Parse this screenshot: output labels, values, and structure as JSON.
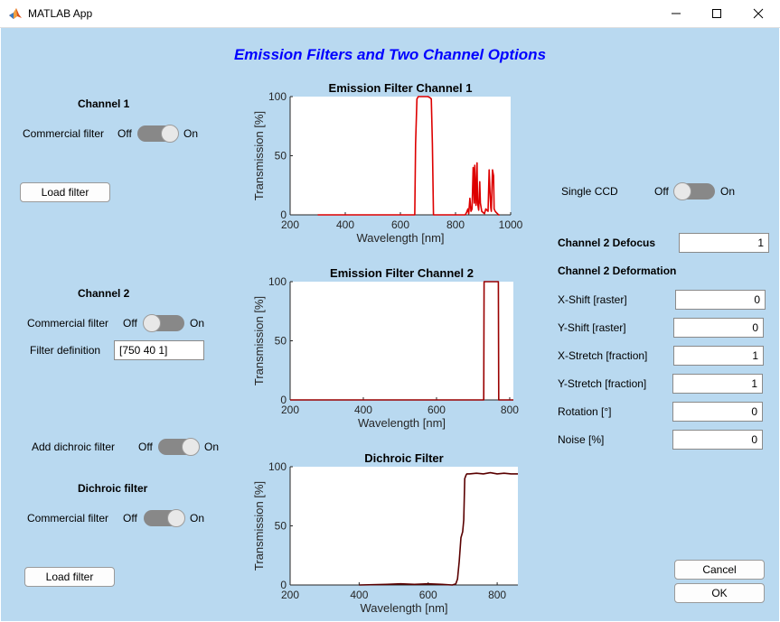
{
  "window": {
    "title": "MATLAB App",
    "minimize_icon": "minimize-icon",
    "maximize_icon": "maximize-icon",
    "close_icon": "close-icon"
  },
  "main_title": "Emission Filters and Two Channel Options",
  "channel1": {
    "heading": "Channel 1",
    "commercial_label": "Commercial filter",
    "off": "Off",
    "on": "On",
    "commercial_state": "off",
    "load_button": "Load filter"
  },
  "channel2": {
    "heading": "Channel 2",
    "commercial_label": "Commercial filter",
    "off": "Off",
    "on": "On",
    "commercial_state": "off",
    "filter_def_label": "Filter definition",
    "filter_def_value": "[750 40 1]"
  },
  "dichroic": {
    "add_label": "Add dichroic filter",
    "off": "Off",
    "on": "On",
    "add_state": "on",
    "heading": "Dichroic filter",
    "commercial_label": "Commercial filter",
    "commercial_state": "on",
    "load_button": "Load filter"
  },
  "right_panel": {
    "single_ccd_label": "Single CCD",
    "off": "Off",
    "on": "On",
    "single_ccd_state": "off",
    "defocus_label": "Channel 2 Defocus",
    "defocus_value": "1",
    "deformation_heading": "Channel 2 Deformation",
    "fields": [
      {
        "label": "X-Shift [raster]",
        "value": "0"
      },
      {
        "label": "Y-Shift [raster]",
        "value": "0"
      },
      {
        "label": "X-Stretch [fraction]",
        "value": "1"
      },
      {
        "label": "Y-Stretch [fraction]",
        "value": "1"
      },
      {
        "label": "Rotation [°]",
        "value": "0"
      },
      {
        "label": "Noise [%]",
        "value": "0"
      }
    ],
    "cancel_button": "Cancel",
    "ok_button": "OK"
  },
  "chart_data": [
    {
      "type": "line",
      "title": "Emission Filter Channel 1",
      "xlabel": "Wavelength [nm]",
      "ylabel": "Transmission [%]",
      "xlim": [
        200,
        1000
      ],
      "ylim": [
        0,
        100
      ],
      "xticks": [
        200,
        400,
        600,
        800,
        1000
      ],
      "yticks": [
        0,
        50,
        100
      ],
      "color": "#dd0000",
      "series": [
        {
          "x": [
            300,
            640,
            652,
            655,
            660,
            665,
            700,
            708,
            712,
            716,
            720,
            800,
            835,
            840,
            845,
            848,
            852,
            856,
            860,
            864,
            868,
            870,
            874,
            878,
            880,
            884,
            888,
            890,
            895,
            900,
            905,
            910,
            918,
            922,
            925,
            928,
            930,
            934,
            938,
            940,
            944,
            948,
            952,
            956,
            960
          ],
          "y": [
            0,
            0,
            0,
            60,
            98,
            100,
            100,
            99,
            98,
            60,
            0,
            0,
            0,
            2,
            5,
            1,
            14,
            3,
            5,
            40,
            10,
            42,
            8,
            44,
            10,
            4,
            28,
            10,
            3,
            2,
            1,
            5,
            3,
            38,
            20,
            6,
            3,
            38,
            33,
            5,
            3,
            2,
            1,
            0,
            0
          ]
        }
      ]
    },
    {
      "type": "line",
      "title": "Emission Filter Channel 2",
      "xlabel": "Wavelength [nm]",
      "ylabel": "Transmission [%]",
      "xlim": [
        200,
        810
      ],
      "ylim": [
        0,
        100
      ],
      "xticks": [
        200,
        400,
        600,
        800
      ],
      "yticks": [
        0,
        50,
        100
      ],
      "color": "#990000",
      "series": [
        {
          "x": [
            200,
            729,
            730,
            731,
            768,
            769,
            770,
            810
          ],
          "y": [
            0,
            0,
            100,
            100,
            100,
            100,
            0,
            0
          ]
        }
      ]
    },
    {
      "type": "line",
      "title": "Dichroic Filter",
      "xlabel": "Wavelength [nm]",
      "ylabel": "Transmission [%]",
      "xlim": [
        200,
        860
      ],
      "ylim": [
        0,
        100
      ],
      "xticks": [
        200,
        400,
        600,
        800
      ],
      "yticks": [
        0,
        50,
        100
      ],
      "color": "#5a0000",
      "series": [
        {
          "x": [
            400,
            480,
            520,
            560,
            600,
            640,
            670,
            680,
            685,
            690,
            695,
            700,
            703,
            706,
            710,
            712,
            715,
            720,
            740,
            760,
            780,
            800,
            820,
            840,
            860
          ],
          "y": [
            0,
            0.5,
            1,
            0.5,
            1,
            0.5,
            0,
            1,
            5,
            20,
            40,
            45,
            55,
            90,
            93,
            94,
            94,
            94,
            94.5,
            94,
            95,
            94,
            94.5,
            94,
            94
          ]
        }
      ]
    }
  ]
}
